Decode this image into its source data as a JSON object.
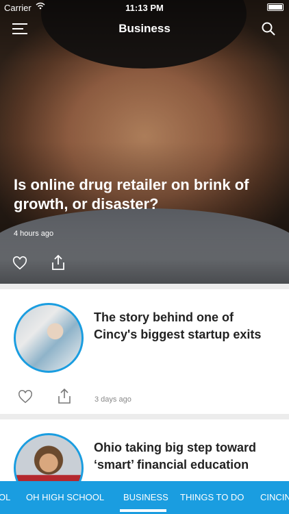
{
  "status_bar": {
    "carrier": "Carrier",
    "time": "11:13 PM"
  },
  "nav": {
    "title": "Business"
  },
  "hero": {
    "title": "Is online drug retailer on brink of growth, or disaster?",
    "time": "4 hours ago"
  },
  "articles": [
    {
      "title": "The story behind one of Cincy's biggest startup exits",
      "time": "3 days ago"
    },
    {
      "title": "Ohio taking big step toward ‘smart’ financial education"
    }
  ],
  "tabs": [
    {
      "label": "OL"
    },
    {
      "label": "OH HIGH SCHOOL"
    },
    {
      "label": "BUSINESS",
      "active": true
    },
    {
      "label": "THINGS TO DO"
    },
    {
      "label": "CINCIN"
    }
  ],
  "colors": {
    "accent": "#1a9de0"
  }
}
